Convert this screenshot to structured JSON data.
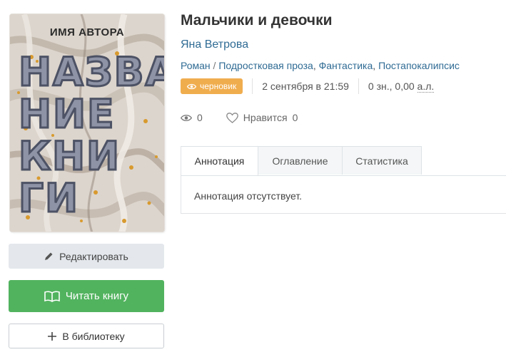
{
  "cover": {
    "author": "ИМЯ АВТОРА",
    "title_lines": [
      "НАЗВА",
      "НИЕ",
      "КНИ",
      "ГИ"
    ]
  },
  "buttons": {
    "edit": "Редактировать",
    "read": "Читать книгу",
    "library": "В библиотеку"
  },
  "book": {
    "title": "Мальчики и девочки",
    "author": "Яна Ветрова",
    "genre_main": "Роман",
    "genres": [
      "Подростковая проза",
      "Фантастика",
      "Постапокалипсис"
    ],
    "status": "черновик",
    "date": "2 сентября в 21:59",
    "size_chars": "0 зн., 0,00",
    "size_unit": "а.л."
  },
  "stats": {
    "views": "0",
    "likes_label": "Нравится",
    "likes": "0"
  },
  "tabs": [
    "Аннотация",
    "Оглавление",
    "Статистика"
  ],
  "annotation": "Аннотация отсутствует.",
  "colors": {
    "link": "#2f6b94",
    "badge": "#f0ad4e",
    "read_button": "#52b35f",
    "edit_button": "#e4e8ec"
  }
}
